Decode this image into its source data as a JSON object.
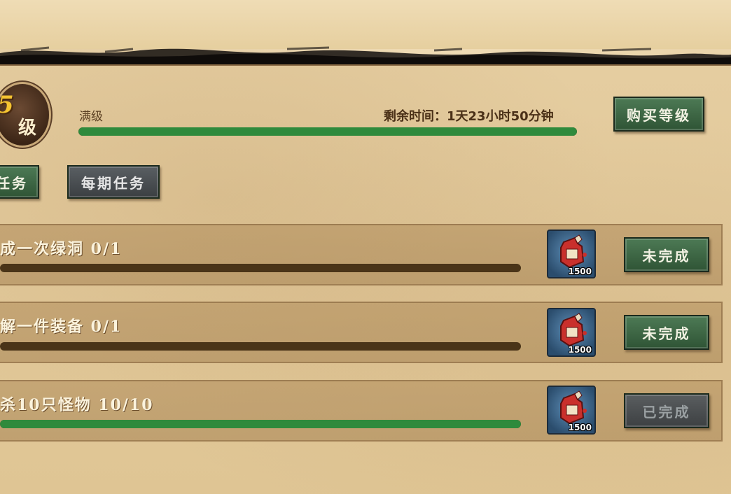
{
  "level": {
    "number": "5",
    "char": "级"
  },
  "progress": {
    "max_label": "满级",
    "time_label": "剩余时间：1天23小时50分钟",
    "fill_fraction": 1.0
  },
  "buy_button": "购买等级",
  "tabs": [
    {
      "label": "任务"
    },
    {
      "label": "每期任务"
    }
  ],
  "tasks": [
    {
      "text": "成一次绿洞 0/1",
      "fill_fraction": 0,
      "reward": {
        "icon": "red-potion-icon",
        "count": "1500"
      },
      "status": "未完成"
    },
    {
      "text": "解一件装备 0/1",
      "fill_fraction": 0,
      "reward": {
        "icon": "red-potion-icon",
        "count": "1500"
      },
      "status": "未完成"
    },
    {
      "text": "杀10只怪物 10/10",
      "fill_fraction": 1,
      "reward": {
        "icon": "red-potion-icon",
        "count": "1500"
      },
      "status": "已完成"
    }
  ],
  "colors": {
    "progress_green": "#2f8a3c",
    "button_green": "#3d6644",
    "button_gray": "#4a4e51",
    "level_gold": "#f5c431"
  }
}
